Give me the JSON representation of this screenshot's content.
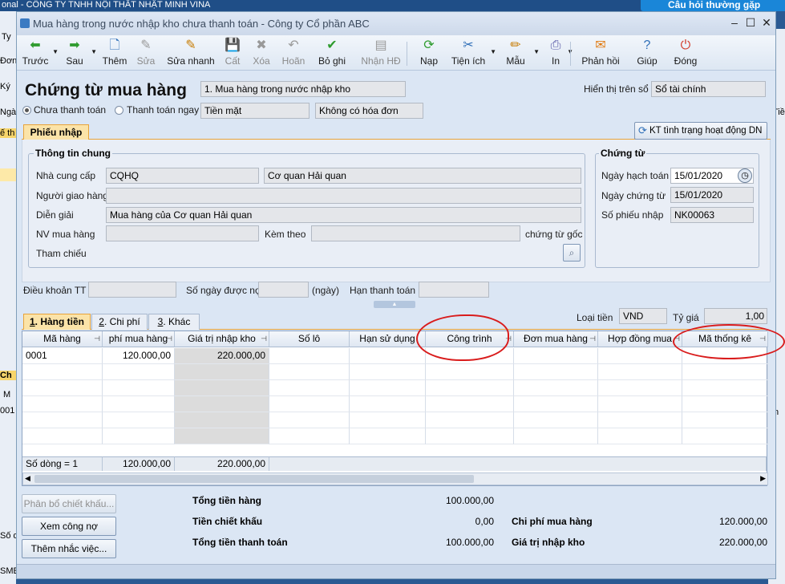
{
  "background": {
    "title": "onal - CÔNG TY TNHH NỘI THẤT NHẬT MINH VINA",
    "help_button": "Câu hỏi thường gặp",
    "left_labels": [
      "Ty",
      "Đơn",
      "Ký",
      "Ngà",
      "ế th",
      "Ch",
      "M",
      "001",
      "Số d",
      "SME"
    ],
    "right_labels": [
      "Tiề",
      "ín"
    ]
  },
  "window": {
    "title": "Mua hàng trong nước nhập kho chưa thanh toán - Công ty Cổ phần ABC",
    "controls": [
      "–",
      "☐",
      "✕"
    ]
  },
  "toolbar": {
    "items": [
      {
        "label": "Trước",
        "icon": "arrow-left-icon",
        "glyph": "⬅",
        "color": "#2e9b2e",
        "enabled": true,
        "dropdown": true
      },
      {
        "label": "Sau",
        "icon": "arrow-right-icon",
        "glyph": "➡",
        "color": "#2e9b2e",
        "enabled": true,
        "dropdown": true
      },
      {
        "label": "Thêm",
        "icon": "add-document-icon",
        "glyph": "🗋",
        "color": "#2f6fb8",
        "enabled": true
      },
      {
        "label": "Sửa",
        "icon": "edit-document-icon",
        "glyph": "✎",
        "color": "#999",
        "enabled": false
      },
      {
        "label": "Sửa nhanh",
        "icon": "quick-edit-icon",
        "glyph": "✎",
        "color": "#c77b00",
        "enabled": true
      },
      {
        "label": "Cất",
        "icon": "save-icon",
        "glyph": "💾",
        "color": "#999",
        "enabled": false
      },
      {
        "label": "Xóa",
        "icon": "delete-icon",
        "glyph": "✖",
        "color": "#999",
        "enabled": false
      },
      {
        "label": "Hoãn",
        "icon": "undo-icon",
        "glyph": "↶",
        "color": "#999",
        "enabled": false
      },
      {
        "label": "Bỏ ghi",
        "icon": "unpost-icon",
        "glyph": "✔",
        "color": "#2e9b2e",
        "enabled": true
      },
      {
        "label": "Nhận HĐ",
        "icon": "receive-invoice-icon",
        "glyph": "▤",
        "color": "#999",
        "enabled": false
      },
      {
        "label": "Nạp",
        "icon": "reload-icon",
        "glyph": "⟳",
        "color": "#2e9b2e",
        "enabled": true
      },
      {
        "label": "Tiện ích",
        "icon": "utilities-icon",
        "glyph": "✂",
        "color": "#2f6fb8",
        "enabled": true,
        "dropdown": true
      },
      {
        "label": "Mẫu",
        "icon": "template-icon",
        "glyph": "✏",
        "color": "#c77b00",
        "enabled": true,
        "dropdown": true
      },
      {
        "label": "In",
        "icon": "print-icon",
        "glyph": "⎙",
        "color": "#5a5aa8",
        "enabled": true,
        "dropdown": true
      },
      {
        "label": "Phản hồi",
        "icon": "feedback-mail-icon",
        "glyph": "✉",
        "color": "#e07a10",
        "enabled": true
      },
      {
        "label": "Giúp",
        "icon": "help-icon",
        "glyph": "?",
        "color": "#2f6fb8",
        "enabled": true
      },
      {
        "label": "Đóng",
        "icon": "close-power-icon",
        "glyph": "⏻",
        "color": "#d23b2a",
        "enabled": true
      }
    ]
  },
  "header": {
    "title": "Chứng từ mua hàng",
    "purchase_type": "1. Mua hàng trong nước nhập kho",
    "show_in_book_label": "Hiển thị trên sổ",
    "show_in_book_value": "Sổ tài chính",
    "unpaid_label": "Chưa thanh toán",
    "pay_now_label": "Thanh toán ngay",
    "payment_method": "Tiền mặt",
    "invoice_status": "Không có hóa đơn"
  },
  "receipt_tab": {
    "label": "Phiếu nhập",
    "check_status_button": "KT tình trạng hoạt động DN"
  },
  "general_info": {
    "title": "Thông tin chung",
    "supplier_label": "Nhà cung cấp",
    "supplier_code": "CQHQ",
    "supplier_name": "Cơ quan Hải quan",
    "deliverer_label": "Người giao hàng",
    "deliverer_value": "",
    "description_label": "Diễn giải",
    "description_value": "Mua hàng của Cơ quan Hải quan",
    "buyer_label": "NV mua hàng",
    "buyer_value": "",
    "attached_label": "Kèm theo",
    "attached_value": "",
    "original_docs_label": "chứng từ gốc",
    "reference_label": "Tham chiếu"
  },
  "voucher": {
    "title": "Chứng từ",
    "posting_date_label": "Ngày hạch toán",
    "posting_date": "15/01/2020",
    "voucher_date_label": "Ngày chứng từ",
    "voucher_date": "15/01/2020",
    "receipt_no_label": "Số phiếu nhập",
    "receipt_no": "NK00063"
  },
  "terms": {
    "payment_terms_label": "Điều khoản TT",
    "payment_terms": "",
    "credit_days_label": "Số ngày được nợ",
    "credit_days": "",
    "days_unit": "(ngày)",
    "due_date_label": "Hạn thanh toán",
    "due_date": ""
  },
  "detail_tabs": [
    {
      "prefix": "1",
      "label": ". Hàng tiền"
    },
    {
      "prefix": "2",
      "label": ". Chi phí"
    },
    {
      "prefix": "3",
      "label": ". Khác"
    }
  ],
  "currency": {
    "label": "Loại tiền",
    "value": "VND",
    "rate_label": "Tỷ giá",
    "rate_value": "1,00"
  },
  "grid": {
    "columns": [
      "Mã hàng",
      "phí mua hàng",
      "Giá trị nhập kho",
      "Số lô",
      "Hạn sử dụng",
      "Công trình",
      "Đơn mua hàng",
      "Hợp đồng mua",
      "Mã thống kê"
    ],
    "rows": [
      [
        "0001",
        "120.000,00",
        "220.000,00",
        "",
        "",
        "",
        "",
        "",
        ""
      ]
    ],
    "footer": {
      "row_count": "Số dòng = 1",
      "purchase_cost_total": "120.000,00",
      "stock_value_total": "220.000,00"
    }
  },
  "actions": {
    "allocate_discount": "Phân bổ chiết khấu...",
    "view_debt": "Xem công nợ",
    "add_reminder": "Thêm nhắc việc..."
  },
  "totals": {
    "goods_total_label": "Tổng tiền hàng",
    "goods_total": "100.000,00",
    "discount_label": "Tiền chiết khấu",
    "discount": "0,00",
    "payment_total_label": "Tổng tiền thanh toán",
    "payment_total": "100.000,00",
    "purchase_cost_label": "Chi phí mua hàng",
    "purchase_cost": "120.000,00",
    "stock_value_label": "Giá trị nhập kho",
    "stock_value": "220.000,00"
  },
  "annotation_color": "#d91c1c"
}
